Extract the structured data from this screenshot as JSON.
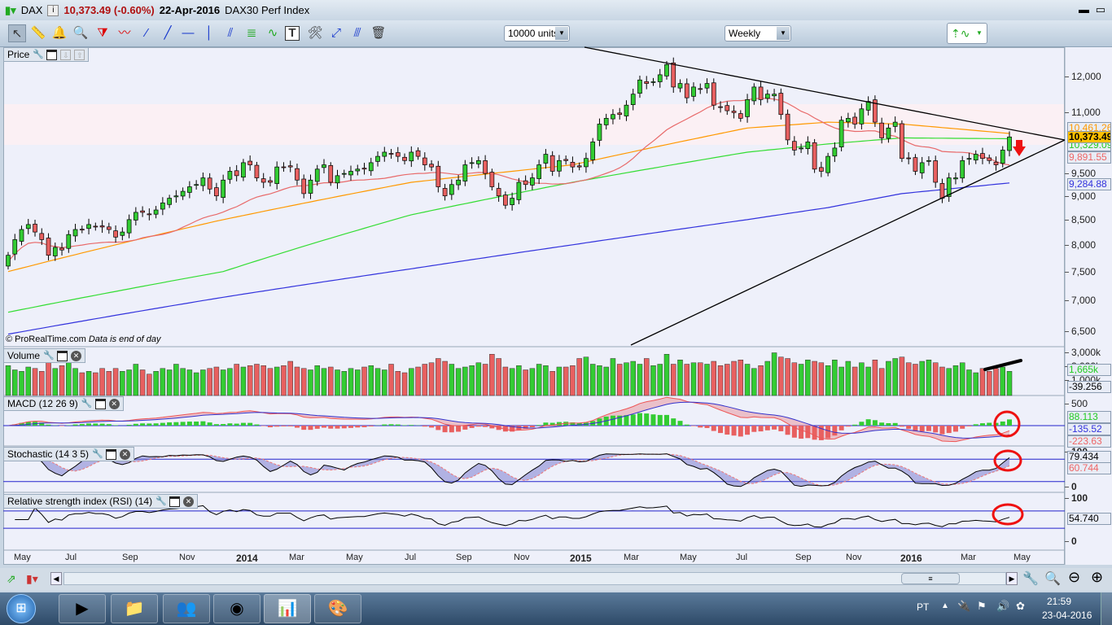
{
  "title": {
    "symbol": "DAX",
    "price": "10,373.49 (-0.60%)",
    "date": "22-Apr-2016",
    "name": "DAX30 Perf Index"
  },
  "toolbar": {
    "units": "10000 units",
    "period": "Weekly",
    "tools": [
      "pointer",
      "ruler",
      "alert-bell",
      "zoom-magnifier",
      "triangle",
      "channel",
      "segment",
      "line",
      "horizontal-line",
      "vertical-line",
      "fibonacci-fan",
      "fibonacci-retracement",
      "trend-channel",
      "text",
      "properties",
      "delete-objects",
      "parallel-line",
      "trash"
    ]
  },
  "panels": {
    "price": "Price",
    "volume": "Volume",
    "macd": "MACD (12 26 9)",
    "stochastic": "Stochastic (14 3 5)",
    "rsi": "Relative strength index (RSI) (14)"
  },
  "copyright": "© ProRealTime.com",
  "data_note": "Data is end of day",
  "price_axis": [
    "12,000",
    "11,000",
    "9,500",
    "9,000",
    "8,500",
    "8,000",
    "7,500",
    "7,000",
    "6,500"
  ],
  "price_boxes": {
    "ma50": "10,461.26",
    "last": "10,373.49",
    "ma100": "10,329.09",
    "ma20": "9,891.55",
    "ma200": "9,284.88"
  },
  "volume_axis": {
    "top": "3,000k",
    "mid": "2,000k",
    "low": "1,000k",
    "box": "1,665k",
    "box2": "-39.256"
  },
  "macd_axis": {
    "top": "500",
    "hist": "88.113",
    "signal": "-135.52",
    "macd": "-223.63"
  },
  "stoch_axis": {
    "top": "100",
    "k": "79.434",
    "d": "60.744",
    "bottom": "0"
  },
  "rsi_axis": {
    "top": "100",
    "value": "54.740",
    "bottom": "0"
  },
  "x_labels": [
    "May",
    "Jul",
    "Sep",
    "Nov",
    "2014",
    "Mar",
    "May",
    "Jul",
    "Sep",
    "Nov",
    "2015",
    "Mar",
    "May",
    "Jul",
    "Sep",
    "Nov",
    "2016",
    "Mar",
    "May"
  ],
  "colors": {
    "up": "#33cc33",
    "down": "#e86060",
    "ma20": "#e86a6a",
    "ma50": "#ff9900",
    "ma100": "#33dd33",
    "ma200": "#3333dd",
    "annotation": "#ee1111"
  },
  "chart_data": {
    "type": "candlestick",
    "period": "weekly",
    "scale": "log",
    "ylim": [
      6300,
      12600
    ],
    "closes": [
      7800,
      8100,
      8300,
      8400,
      8250,
      8100,
      7800,
      7950,
      7900,
      8200,
      8300,
      8300,
      8400,
      8350,
      8350,
      8300,
      8150,
      8250,
      8500,
      8650,
      8650,
      8600,
      8700,
      8850,
      8950,
      9000,
      9100,
      9200,
      9250,
      9400,
      9150,
      9000,
      9350,
      9550,
      9450,
      9750,
      9700,
      9400,
      9300,
      9300,
      9650,
      9650,
      9650,
      9350,
      9050,
      9350,
      9600,
      9700,
      9300,
      9450,
      9500,
      9550,
      9600,
      9600,
      9750,
      9900,
      10000,
      9950,
      9900,
      9800,
      10000,
      9900,
      9700,
      9650,
      9200,
      9000,
      9250,
      9350,
      9700,
      9750,
      9800,
      9500,
      9200,
      9000,
      8800,
      8950,
      9300,
      9250,
      9400,
      9700,
      9950,
      9550,
      9800,
      9800,
      9650,
      9650,
      9850,
      10250,
      10700,
      10850,
      10950,
      10950,
      11200,
      11500,
      11900,
      11800,
      11850,
      12050,
      12350,
      11700,
      11800,
      11400,
      11700,
      11650,
      11800,
      11200,
      11150,
      11050,
      11000,
      10850,
      11350,
      11700,
      11350,
      11500,
      11500,
      10950,
      10300,
      10050,
      10100,
      10250,
      9600,
      9550,
      9900,
      10100,
      10800,
      10850,
      10700,
      11100,
      11300,
      10750,
      10350,
      10600,
      10750,
      9850,
      9850,
      9550,
      9750,
      9800,
      9300,
      8950,
      9400,
      9400,
      9800,
      9850,
      9950,
      9850,
      9800,
      9700,
      10050,
      10373.49
    ],
    "volumes_k": [
      2100,
      1800,
      1700,
      2000,
      1900,
      1700,
      2300,
      1900,
      2100,
      2300,
      1900,
      1600,
      1700,
      1600,
      1900,
      1700,
      1900,
      1700,
      1800,
      2200,
      1800,
      1500,
      1700,
      1900,
      1800,
      2200,
      1900,
      1800,
      1600,
      1800,
      1900,
      2000,
      1800,
      1900,
      2200,
      2000,
      2100,
      2200,
      2100,
      1900,
      2000,
      2100,
      2400,
      2000,
      1900,
      1800,
      2100,
      1900,
      2000,
      1800,
      1700,
      1900,
      1800,
      2000,
      2100,
      1900,
      1800,
      2200,
      1700,
      1600,
      1900,
      2000,
      2200,
      2300,
      2600,
      2400,
      2200,
      1900,
      2000,
      2100,
      2300,
      2200,
      2900,
      2600,
      2000,
      1900,
      2100,
      1800,
      1900,
      2200,
      2100,
      1700,
      2000,
      2000,
      2100,
      2600,
      2700,
      2200,
      2100,
      2000,
      2600,
      2200,
      2300,
      2400,
      2200,
      2600,
      2100,
      2200,
      2900,
      2200,
      2500,
      2200,
      2300,
      2300,
      2200,
      2400,
      2100,
      2200,
      2400,
      2500,
      2200,
      1900,
      2100,
      2400,
      3000,
      2700,
      2600,
      2300,
      2200,
      2500,
      2400,
      2300,
      2100,
      2500,
      2000,
      2400,
      2000,
      2300,
      2000,
      2500,
      1900,
      2400,
      2600,
      2700,
      2300,
      2200,
      2400,
      2500,
      2300,
      2000,
      1900,
      2100,
      2300,
      1800,
      1600,
      1900,
      1700,
      1900,
      2000,
      1700,
      1665
    ],
    "ma50": [
      7500,
      8500,
      9300,
      9700,
      10600,
      10750,
      10700,
      10461.26
    ],
    "ma100": [
      6800,
      7500,
      8600,
      9300,
      10000,
      10200,
      10350,
      10329.09
    ],
    "ma200": [
      6450,
      7050,
      7550,
      8000,
      8500,
      8750,
      9050,
      9284.88
    ],
    "ma_anchor_weeks": [
      0,
      32,
      60,
      84,
      110,
      122,
      133,
      149
    ],
    "trendlines": [
      {
        "from": [
          0,
          "2015-04"
        ],
        "desc": "descending resistance"
      },
      {
        "desc": "ascending support"
      }
    ]
  },
  "status": {
    "lang": "PT",
    "time": "21:59",
    "date": "23-04-2016"
  }
}
